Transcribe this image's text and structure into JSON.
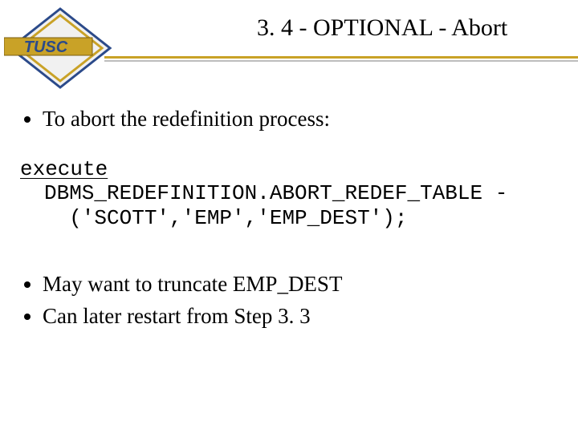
{
  "logo": {
    "text": "TUSC"
  },
  "title": "3. 4 - OPTIONAL - Abort",
  "bullets1": [
    "To abort the redefinition process:"
  ],
  "code": {
    "exec": "execute",
    "line1": "DBMS_REDEFINITION.ABORT_REDEF_TABLE -",
    "line2": "  ('SCOTT','EMP','EMP_DEST');"
  },
  "bullets2": [
    "May want to truncate EMP_DEST",
    "Can later restart from Step 3. 3"
  ]
}
